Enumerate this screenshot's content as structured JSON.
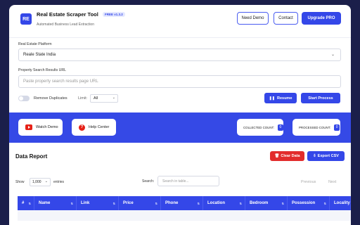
{
  "header": {
    "logo_text": "RE",
    "title": "Real Estate Scraper Tool",
    "version": "FREE v1.3.2",
    "subtitle": "Automated Business Lead Extraction",
    "buttons": {
      "need_demo": "Need Demo",
      "contact": "Contact",
      "upgrade": "Upgrade PRO"
    }
  },
  "form": {
    "platform_label": "Real Estate Platform",
    "platform_value": "Reale State India",
    "url_label": "Property Search Results URL",
    "url_placeholder": "Paste property search results page URL",
    "remove_duplicates_label": "Remove Duplicates",
    "remove_duplicates_on": false,
    "limit_label": "Limit:",
    "limit_value": "All",
    "resume_label": "Resume",
    "start_label": "Start Process"
  },
  "toolbar": {
    "watch_demo": "Watch Demo",
    "help_center": "Help Center",
    "collected_label": "COLLECTED COUNT:",
    "collected_count": "0",
    "processed_label": "PROCESSED COUNT:",
    "processed_count": "0"
  },
  "report": {
    "title": "Data Report",
    "clear_label": "Clear Data",
    "export_label": "Export CSV",
    "show_label": "Show",
    "entries_value": "1,000",
    "entries_label": "entries",
    "search_label": "Search:",
    "search_placeholder": "Search in table...",
    "previous_label": "Previous",
    "next_label": "Next",
    "columns": [
      "#",
      "Name",
      "Link",
      "Price",
      "Phone",
      "Location",
      "Bedroom",
      "Possession",
      "Locality"
    ]
  },
  "colors": {
    "primary": "#3447e8",
    "danger": "#e22c2c",
    "background": "#1b1f4a"
  }
}
